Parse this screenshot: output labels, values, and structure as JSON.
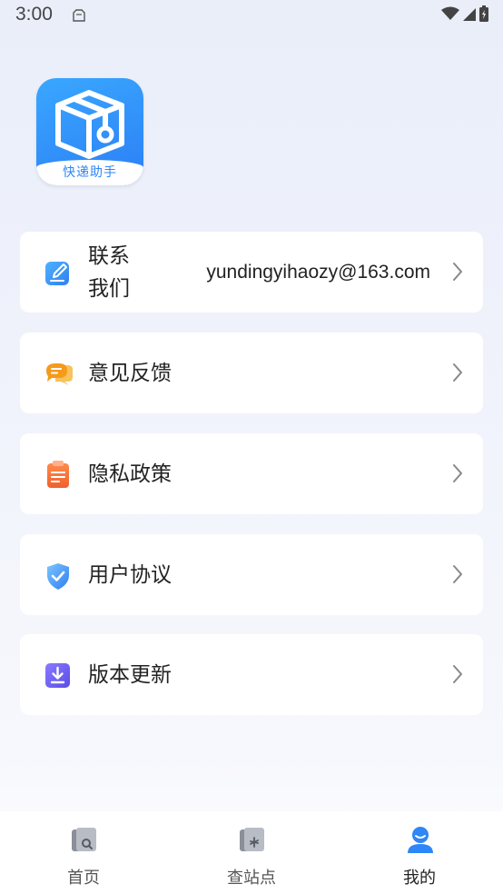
{
  "status_bar": {
    "time": "3:00"
  },
  "logo": {
    "label": "快递助手"
  },
  "menu": [
    {
      "label": "联系我们",
      "value": "yundingyihaozy@163.com",
      "icon": "edit-icon",
      "color": "#2f86f6"
    },
    {
      "label": "意见反馈",
      "value": "",
      "icon": "chat-bubble-icon",
      "color": "#f5a623"
    },
    {
      "label": "隐私政策",
      "value": "",
      "icon": "clipboard-icon",
      "color": "#f36b3b"
    },
    {
      "label": "用户协议",
      "value": "",
      "icon": "shield-check-icon",
      "color": "#2f86f6"
    },
    {
      "label": "版本更新",
      "value": "",
      "icon": "download-icon",
      "color": "#6b5cf0"
    }
  ],
  "tabs": [
    {
      "label": "首页",
      "icon": "home-search-icon"
    },
    {
      "label": "查站点",
      "icon": "station-icon"
    },
    {
      "label": "我的",
      "icon": "user-icon",
      "active": true
    }
  ],
  "colors": {
    "accent": "#2f86f6",
    "inactive_icon": "#8a8f99"
  }
}
